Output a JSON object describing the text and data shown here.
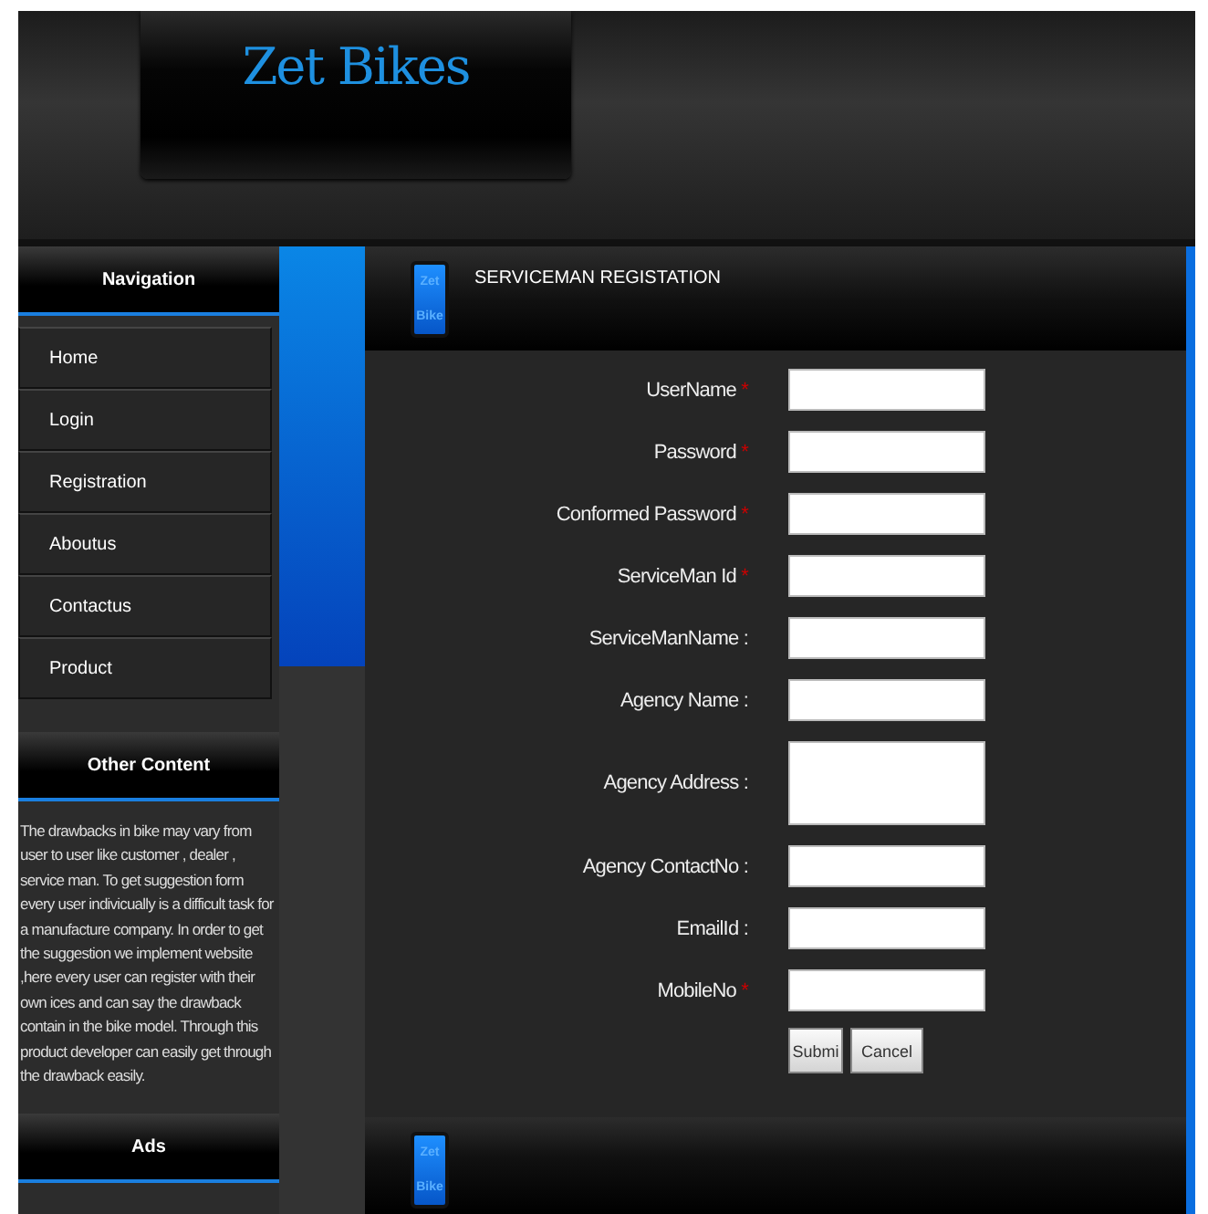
{
  "header": {
    "logo": "Zet Bikes"
  },
  "sidebar": {
    "navigation": {
      "title": "Navigation",
      "items": [
        {
          "label": "Home"
        },
        {
          "label": "Login"
        },
        {
          "label": "Registration"
        },
        {
          "label": "Aboutus"
        },
        {
          "label": "Contactus"
        },
        {
          "label": "Product"
        }
      ]
    },
    "other_content": {
      "title": "Other Content",
      "text": "The drawbacks in bike may vary from user to user like customer , dealer , service man. To get suggestion form every user indivicually is a difficult task for a manufacture company. In order to get the suggestion we implement website ,here every user can register with their own ices and can say the drawback contain in the bike model. Through this product developer can easily get through the drawback easily."
    },
    "ads": {
      "title": "Ads"
    }
  },
  "form": {
    "badge": [
      "Zet",
      "Bike"
    ],
    "title": "SERVICEMAN REGISTATION",
    "fields": [
      {
        "label": "UserName",
        "required": true,
        "kind": "input"
      },
      {
        "label": "Password",
        "required": true,
        "kind": "input"
      },
      {
        "label": "Conformed Password",
        "required": true,
        "kind": "input"
      },
      {
        "label": "ServiceMan Id",
        "required": true,
        "kind": "input"
      },
      {
        "label": "ServiceManName :",
        "required": false,
        "kind": "input"
      },
      {
        "label": "Agency Name :",
        "required": false,
        "kind": "input"
      },
      {
        "label": "Agency Address :",
        "required": false,
        "kind": "textarea"
      },
      {
        "label": "Agency ContactNo :",
        "required": false,
        "kind": "input"
      },
      {
        "label": "EmailId :",
        "required": false,
        "kind": "input"
      },
      {
        "label": "MobileNo",
        "required": true,
        "kind": "input"
      }
    ],
    "required_mark": "*",
    "buttons": [
      "Submi",
      "Cancel"
    ]
  },
  "footer": {
    "badge": [
      "Zet",
      "Bike"
    ]
  }
}
